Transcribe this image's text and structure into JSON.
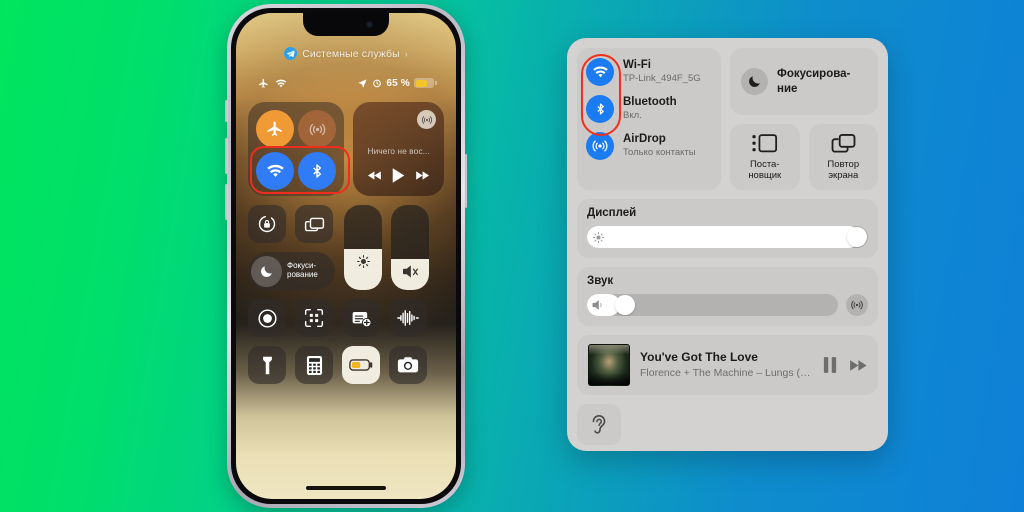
{
  "background": {
    "gradient_from": "#00e45d",
    "gradient_mid": "#0aa8b4",
    "gradient_to": "#0f80d8"
  },
  "accents": {
    "highlight_red": "#ef2d1f",
    "ios_blue": "#2f7cf6",
    "ios_orange": "#f09a36",
    "mac_blue": "#1b7bf0",
    "battery_yellow": "#f2c42a"
  },
  "phone": {
    "services_pill": {
      "app_icon": "telegram-icon",
      "label": "Системные службы",
      "chevron": "›"
    },
    "status_bar": {
      "left_icons": [
        "airplane-mode-icon",
        "wifi-icon"
      ],
      "location_icon": "location-arrow-icon",
      "alarm_icon": "alarm-clock-icon",
      "battery_percent": "65 %",
      "battery_level": 65,
      "battery_low_power": true
    },
    "connectivity": {
      "airplane": {
        "icon": "airplane-icon",
        "state": "on"
      },
      "cellular": {
        "icon": "cellular-antenna-icon",
        "state": "off"
      },
      "wifi": {
        "icon": "wifi-icon",
        "state": "on"
      },
      "bluetooth": {
        "icon": "bluetooth-icon",
        "state": "on"
      },
      "highlighted": true
    },
    "media_widget": {
      "now_playing": "Ничего не вос...",
      "airplay_icon": "airplay-audio-icon",
      "prev_icon": "rewind-icon",
      "play_icon": "play-icon",
      "next_icon": "fast-forward-icon"
    },
    "tiles": {
      "rotation_lock": "rotation-lock-icon",
      "screen_mirroring": "screen-mirroring-icon",
      "focus_label": "Фокуси-\nрование",
      "focus_label_line1": "Фокуси-",
      "focus_label_line2": "рование",
      "focus_icon": "moon-icon",
      "brightness_icon": "brightness-sun-icon",
      "brightness_level": 52,
      "volume_icon": "speaker-mute-icon",
      "volume_level": 40,
      "screen_record": "record-icon",
      "code_scanner": "qr-scanner-icon",
      "quick_note": "quick-note-icon",
      "sound_recognition": "sound-waveform-icon",
      "flashlight": "flashlight-icon",
      "calculator": "calculator-icon",
      "low_power": "battery-icon",
      "low_power_active": true,
      "camera": "camera-icon"
    }
  },
  "mac_control_center": {
    "connectivity": [
      {
        "icon": "wifi-icon",
        "title": "Wi-Fi",
        "subtitle": "TP-Link_494F_5G",
        "highlighted": true
      },
      {
        "icon": "bluetooth-icon",
        "title": "Bluetooth",
        "subtitle": "Вкл.",
        "highlighted": true
      },
      {
        "icon": "airdrop-icon",
        "title": "AirDrop",
        "subtitle": "Только контакты",
        "highlighted": false
      }
    ],
    "focus": {
      "icon": "moon-icon",
      "label_line1": "Фокусирова-",
      "label_line2": "ние"
    },
    "stage_manager": {
      "icon": "stage-manager-icon",
      "label_line1": "Поста-",
      "label_line2": "новщик"
    },
    "screen_mirroring": {
      "icon": "screen-mirroring-icon",
      "label_line1": "Повтор",
      "label_line2": "экрана"
    },
    "display": {
      "header": "Дисплей",
      "icon": "brightness-sun-icon",
      "level": 97
    },
    "sound": {
      "header": "Звук",
      "icon": "speaker-icon",
      "level": 13,
      "airplay_icon": "airplay-audio-icon"
    },
    "media": {
      "title": "You've Got The Love",
      "subtitle": "Florence + The Machine – Lungs (D…",
      "album_art": "album-artwork",
      "pause_icon": "pause-icon",
      "next_icon": "fast-forward-icon"
    },
    "accessibility": {
      "icon": "hearing-ear-icon"
    }
  }
}
